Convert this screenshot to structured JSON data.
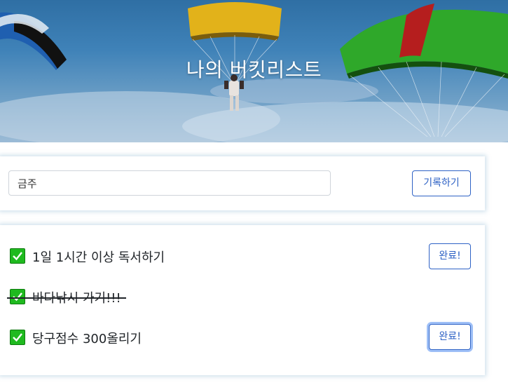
{
  "header": {
    "title": "나의 버킷리스트"
  },
  "input_section": {
    "value": "금주",
    "button_label": "기록하기"
  },
  "bucket_list": {
    "items": [
      {
        "text": "1일 1시간 이상 독서하기",
        "done": false,
        "button_label": "완료!"
      },
      {
        "text": "바다낚시 가기!!!",
        "done": true
      },
      {
        "text": "당구점수 300올리기",
        "done": false,
        "button_label": "완료!"
      }
    ]
  },
  "colors": {
    "accent": "#2e62c5",
    "check_green": "#1fba1f"
  }
}
